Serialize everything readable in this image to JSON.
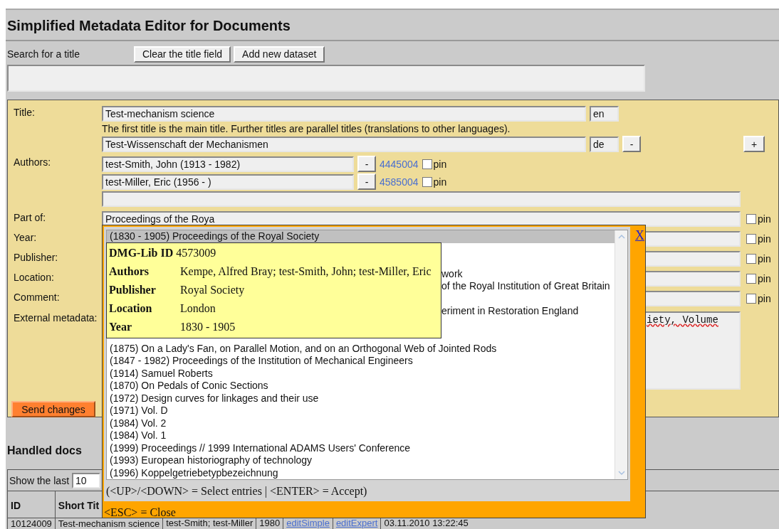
{
  "title": "Simplified Metadata Editor for Documents",
  "search": {
    "label": "Search for a title",
    "buttons": [
      "Clear the title field",
      "Add new dataset"
    ]
  },
  "form": {
    "titles": {
      "label": "Title:",
      "hint": "The first title is the main title. Further titles are parallel titles (translations to other languages).",
      "add": "+",
      "entries": [
        {
          "value": "Test-mechanism science",
          "lang": "en"
        },
        {
          "value": "Test-Wissenschaft der Mechanismen",
          "lang": "de",
          "remove": "-"
        }
      ]
    },
    "authors": {
      "label": "Authors:",
      "entries": [
        {
          "name": "test-Smith, John (1913 - 1982)",
          "remove": "-",
          "id": "4445004",
          "pin": "pin",
          "pinned": false
        },
        {
          "name": "test-Miller, Eric (1956 -  )",
          "remove": "-",
          "id": "4585004",
          "pin": "pin",
          "pinned": false
        }
      ]
    },
    "fields": [
      {
        "label": "Part of:",
        "value": "Proceedings of the Roya",
        "pin": "pin",
        "pinned": false
      },
      {
        "label": "Year:",
        "pin": "pin",
        "pinned": false
      },
      {
        "label": "Publisher:",
        "pin": "pin",
        "pinned": false
      },
      {
        "label": "Location:",
        "pin": "pin",
        "pinned": false
      },
      {
        "label": "Comment:",
        "pin": "pin",
        "pinned": false
      }
    ],
    "external": {
      "label": "External metadata:",
      "value": "iety, Volume"
    },
    "send": "Send changes"
  },
  "handled": {
    "heading": "Handled docs",
    "show_label": "Show the last",
    "show_value": "10",
    "columns": [
      "ID",
      "Short Tit"
    ],
    "rows": [
      [
        "10124009",
        "Test-mechanism science",
        "test-Smith; test-Miller",
        "1980",
        "editSimple",
        "editExpert",
        "03.11.2010 13:22:45"
      ]
    ]
  },
  "autocomplete": {
    "close": "X",
    "items": [
      {
        "text": "(1830 - 1905) Proceedings of the Royal Society",
        "kind": "entry",
        "selected": true
      },
      {
        "text": "work",
        "kind": "partial",
        "selected": false
      },
      {
        "text": "of the Royal Institution of Great Britain",
        "kind": "partial",
        "selected": false
      },
      {
        "text": "eriment in Restoration England",
        "kind": "partial",
        "selected": false
      },
      {
        "text": "(1875) On a Lady's Fan, on Parallel Motion, and on an Orthogonal Web of Jointed Rods",
        "kind": "entry",
        "selected": false
      },
      {
        "text": "(1847 - 1982) Proceedings of the Institution of Mechanical Engineers",
        "kind": "entry",
        "selected": false
      },
      {
        "text": "(1914) Samuel Roberts",
        "kind": "entry",
        "selected": false
      },
      {
        "text": "(1870) On Pedals of Conic Sections",
        "kind": "entry",
        "selected": false
      },
      {
        "text": "(1972) Design curves for linkages and their use",
        "kind": "entry",
        "selected": false
      },
      {
        "text": "(1971) Vol. D",
        "kind": "entry",
        "selected": false
      },
      {
        "text": "(1984) Vol. 2",
        "kind": "entry",
        "selected": false
      },
      {
        "text": "(1984) Vol. 1",
        "kind": "entry",
        "selected": false
      },
      {
        "text": "(1999) Proceedings // 1999 International ADAMS Users' Conference",
        "kind": "entry",
        "selected": false
      },
      {
        "text": "(1993) European historiography of technology",
        "kind": "entry",
        "selected": false
      },
      {
        "text": "(1996) Koppelgetriebetypbezeichnung",
        "kind": "entry",
        "selected": false
      }
    ],
    "help": "(<UP>/<DOWN> = Select entries | <ENTER> = Accept)",
    "esc": "<ESC> = Close"
  },
  "tooltip": {
    "rows": [
      {
        "label": "DMG-Lib ID",
        "value": "4573009"
      },
      {
        "label": "Authors",
        "value": "Kempe, Alfred Bray; test-Smith, John; test-Miller, Eric"
      },
      {
        "label": "Publisher",
        "value": "Royal Society"
      },
      {
        "label": "Location",
        "value": "London"
      },
      {
        "label": "Year",
        "value": "1830 - 1905"
      }
    ]
  }
}
